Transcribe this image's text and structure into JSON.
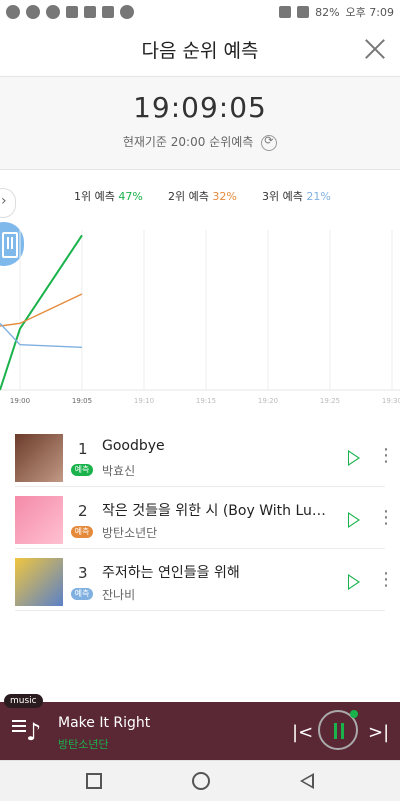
{
  "status_bar": {
    "battery": "82%",
    "time": "오후 7:09"
  },
  "header": {
    "title": "다음 순위 예측"
  },
  "time_panel": {
    "clock": "19:09:05",
    "subtitle": "현재기준 20:00 순위예측"
  },
  "legend": [
    {
      "label": "1위 예측",
      "pct": "47%",
      "color": "#19b24b"
    },
    {
      "label": "2위 예측",
      "pct": "32%",
      "color": "#e58a3a"
    },
    {
      "label": "3위 예측",
      "pct": "21%",
      "color": "#7fb0e0"
    }
  ],
  "chart_data": {
    "type": "line",
    "x_ticks": [
      "19:00",
      "19:05",
      "19:10",
      "19:15",
      "19:20",
      "19:25",
      "19:30"
    ],
    "series": [
      {
        "color": "#19b24b",
        "points": [
          [
            0,
            0
          ],
          [
            20,
            23
          ],
          [
            82,
            58
          ]
        ]
      },
      {
        "color": "#e58a3a",
        "points": [
          [
            0,
            24
          ],
          [
            20,
            25
          ],
          [
            82,
            36
          ]
        ]
      },
      {
        "color": "#7fb0e0",
        "points": [
          [
            0,
            25
          ],
          [
            20,
            17
          ],
          [
            82,
            16
          ]
        ]
      }
    ]
  },
  "list": {
    "badge_label": "예측",
    "items": [
      {
        "rank": "1",
        "title": "Goodbye",
        "artist": "박효신",
        "badge_color": "#19b24b",
        "art_colors": [
          "#6b3b2a",
          "#c29a86"
        ]
      },
      {
        "rank": "2",
        "title": "작은 것들을 위한 시 (Boy With Luv) (Feat. Halsey)",
        "artist": "방탄소년단",
        "badge_color": "#e58a3a",
        "art_colors": [
          "#f48aa8",
          "#ffc0d2"
        ]
      },
      {
        "rank": "3",
        "title": "주저하는 연인들을 위해",
        "artist": "잔나비",
        "badge_color": "#7fb0e0",
        "art_colors": [
          "#f0c640",
          "#5a80c8"
        ]
      }
    ]
  },
  "player": {
    "tag": "music",
    "song": "Make It Right",
    "artist": "방탄소년단"
  }
}
